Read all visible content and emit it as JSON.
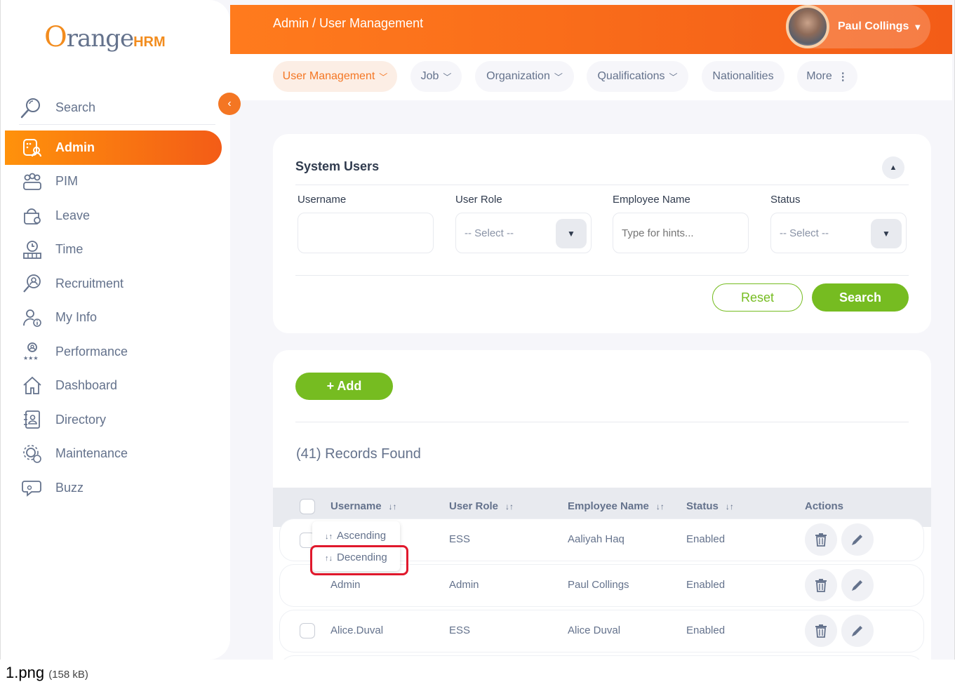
{
  "brand": {
    "logo_o": "O",
    "logo_range": "range",
    "logo_hrm": "HRM"
  },
  "header": {
    "breadcrumb": "Admin / User Management",
    "user_name": "Paul Collings"
  },
  "sidebar": {
    "search_label": "Search",
    "items": [
      {
        "label": "Admin",
        "icon": "admin-icon",
        "active": true
      },
      {
        "label": "PIM",
        "icon": "pim-icon"
      },
      {
        "label": "Leave",
        "icon": "leave-icon"
      },
      {
        "label": "Time",
        "icon": "time-icon"
      },
      {
        "label": "Recruitment",
        "icon": "recruitment-icon"
      },
      {
        "label": "My Info",
        "icon": "my-info-icon"
      },
      {
        "label": "Performance",
        "icon": "performance-icon"
      },
      {
        "label": "Dashboard",
        "icon": "dashboard-icon"
      },
      {
        "label": "Directory",
        "icon": "directory-icon"
      },
      {
        "label": "Maintenance",
        "icon": "maintenance-icon"
      },
      {
        "label": "Buzz",
        "icon": "buzz-icon"
      }
    ]
  },
  "tabs": [
    {
      "label": "User Management",
      "has_dropdown": true,
      "active": true
    },
    {
      "label": "Job",
      "has_dropdown": true
    },
    {
      "label": "Organization",
      "has_dropdown": true
    },
    {
      "label": "Qualifications",
      "has_dropdown": true
    },
    {
      "label": "Nationalities"
    },
    {
      "label": "More"
    }
  ],
  "filter": {
    "title": "System Users",
    "username_label": "Username",
    "username_value": "",
    "role_label": "User Role",
    "role_value": "-- Select --",
    "employee_label": "Employee Name",
    "employee_placeholder": "Type for hints...",
    "status_label": "Status",
    "status_value": "-- Select --",
    "reset_label": "Reset",
    "search_label": "Search"
  },
  "list": {
    "add_label": "+  Add",
    "records_text": "(41) Records Found",
    "columns": [
      "Username",
      "User Role",
      "Employee Name",
      "Status",
      "Actions"
    ],
    "rows": [
      {
        "username": "",
        "role": "ESS",
        "employee": "Aaliyah Haq",
        "status": "Enabled"
      },
      {
        "username": "Admin",
        "role": "Admin",
        "employee": "Paul Collings",
        "status": "Enabled"
      },
      {
        "username": "Alice.Duval",
        "role": "ESS",
        "employee": "Alice Duval",
        "status": "Enabled"
      }
    ]
  },
  "sort_menu": {
    "ascending": "Ascending",
    "descending": "Decending"
  },
  "caption": {
    "filename": "1.png",
    "size": "(158 kB)"
  },
  "colors": {
    "accent": "#f47623",
    "green": "#76bc21",
    "highlight": "#e0182c"
  }
}
